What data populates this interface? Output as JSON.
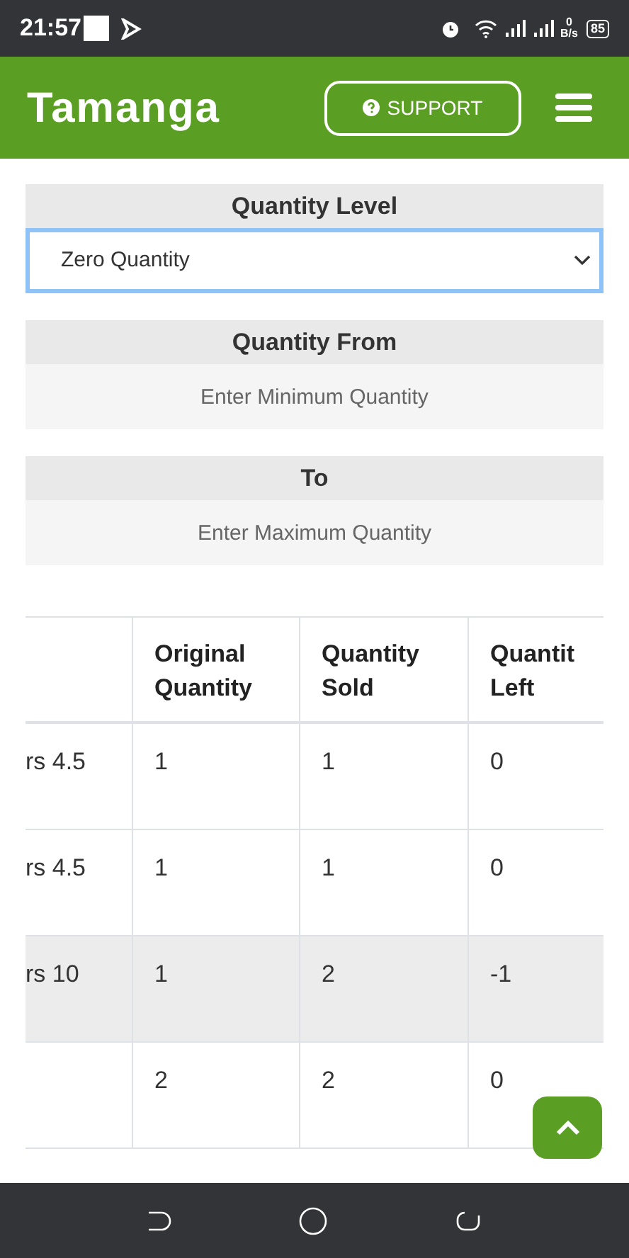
{
  "status_bar": {
    "time": "21:57",
    "speed_value": "0",
    "speed_unit": "B/s",
    "battery": "85"
  },
  "header": {
    "brand": "Tamanga",
    "support_button": "SUPPORT"
  },
  "filters": [
    {
      "kind": "select",
      "label": "Quantity Level",
      "value": "Zero Quantity",
      "focused": true
    },
    {
      "kind": "input",
      "label": "Quantity From",
      "placeholder": "Enter Minimum Quantity"
    },
    {
      "kind": "input",
      "label": "To",
      "placeholder": "Enter Maximum Quantity"
    }
  ],
  "table": {
    "columns": [
      "",
      "Original Quantity",
      "Quantity Sold",
      "Quantit Left"
    ],
    "rows": [
      {
        "cells": [
          "rs 4.5",
          "1",
          "1",
          "0"
        ],
        "highlighted": false
      },
      {
        "cells": [
          "rs 4.5",
          "1",
          "1",
          "0"
        ],
        "highlighted": false
      },
      {
        "cells": [
          "rs 10",
          "1",
          "2",
          "-1"
        ],
        "highlighted": true
      },
      {
        "cells": [
          "",
          "2",
          "2",
          "0"
        ],
        "highlighted": false
      }
    ]
  }
}
